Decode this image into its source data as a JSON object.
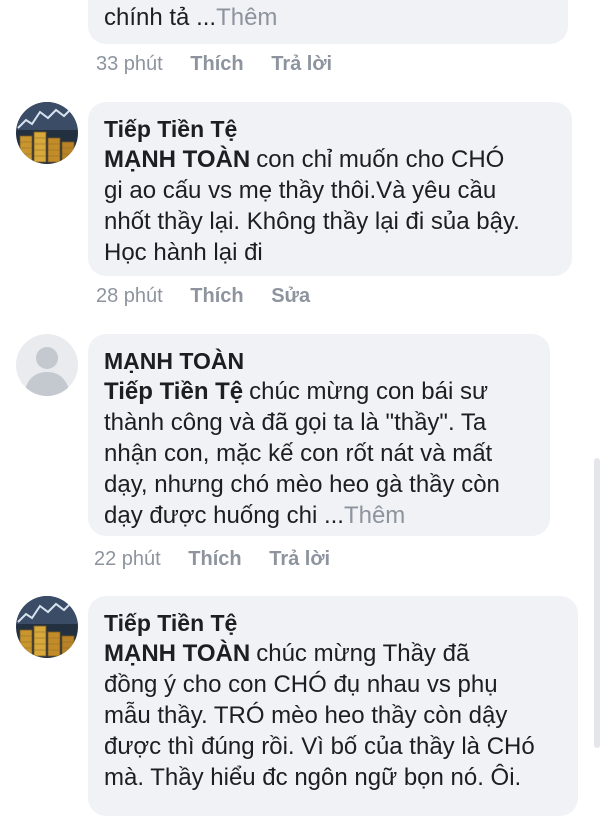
{
  "comments": [
    {
      "author": "",
      "lines": [
        "chính tả ..."
      ],
      "more": "Thêm",
      "time": "33 phút",
      "actions": [
        "Thích",
        "Trả lời"
      ]
    },
    {
      "author": "Tiếp Tiền Tệ",
      "mention": "MẠNH TOÀN",
      "lines": [
        "con chỉ muốn cho CHÓ",
        "gi ao cấu vs mẹ thầy thôi.Và yêu cầu",
        "nhốt thầy lại. Không thầy lại đi sủa bậy.",
        "Học hành lại đi"
      ],
      "time": "28 phút",
      "actions": [
        "Thích",
        "Sửa"
      ]
    },
    {
      "author": "MẠNH TOÀN",
      "mention": "Tiếp Tiền Tệ",
      "lines": [
        "chúc mừng con bái sư",
        "thành công và đã gọi ta là \"thầy\". Ta",
        "nhận con, mặc kế con rốt nát và mất",
        "dạy, nhưng chó mèo heo gà thầy còn",
        "dạy được huống chi ..."
      ],
      "more": "Thêm",
      "time": "22 phút",
      "actions": [
        "Thích",
        "Trả lời"
      ]
    },
    {
      "author": "Tiếp Tiền Tệ",
      "mention": "MẠNH TOÀN",
      "lines": [
        "chúc mừng Thầy đã",
        "đồng ý cho con CHÓ đụ nhau vs phụ",
        "mẫu thầy. TRÓ mèo heo thầy còn dậy",
        "được thì đúng rồi. Vì bố của thầy là CHó",
        "mà. Thầy hiểu đc ngôn ngữ bọn nó. Ôi."
      ]
    }
  ],
  "icons": {
    "avatar_tiep": "stock-chart-coins-avatar",
    "avatar_manh": "default-person-avatar"
  }
}
